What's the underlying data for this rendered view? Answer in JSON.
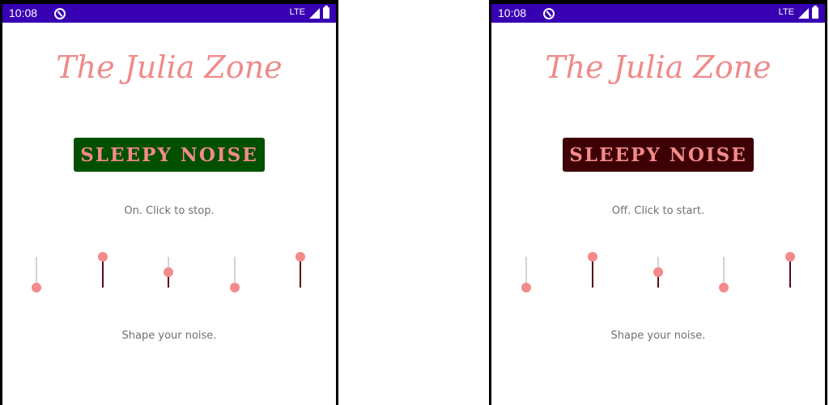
{
  "screens": [
    {
      "status": {
        "time": "10:08",
        "network": "LTE"
      },
      "title": "The Julia Zone",
      "button": {
        "label": "SLEEPY NOISE",
        "bg_color": "#005000",
        "text_color": "#f48a8a"
      },
      "state_text": "On. Click to stop.",
      "slider_levels": [
        0.0,
        1.0,
        0.5,
        0.0,
        1.0
      ],
      "footer_text": "Shape your noise."
    },
    {
      "status": {
        "time": "10:08",
        "network": "LTE"
      },
      "title": "The Julia Zone",
      "button": {
        "label": "SLEEPY NOISE",
        "bg_color": "#3d0005",
        "text_color": "#f48a8a"
      },
      "state_text": "Off. Click to start.",
      "slider_levels": [
        0.0,
        1.0,
        0.5,
        0.0,
        1.0
      ],
      "footer_text": "Shape your noise."
    }
  ],
  "colors": {
    "status_bar": "#3700b3",
    "accent": "#f48a8a",
    "slider_fill": "#5a0a14",
    "slider_track": "#d3d3d3",
    "text_gray": "#707070"
  }
}
